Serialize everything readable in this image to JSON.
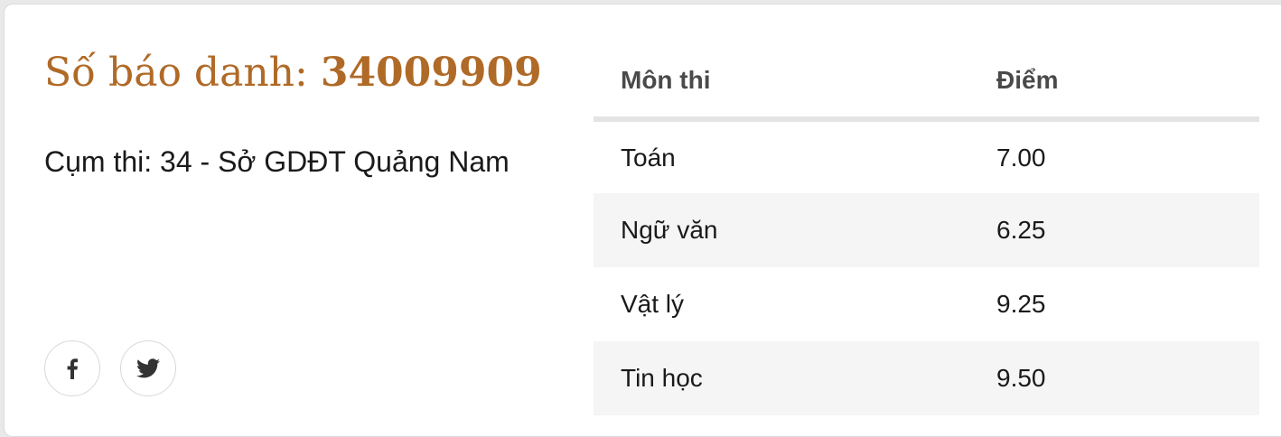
{
  "header": {
    "label": "Số báo danh:",
    "number": "34009909"
  },
  "cluster": "Cụm thi: 34 - Sở GDĐT Quảng Nam",
  "share": {
    "items": [
      {
        "icon": "facebook-icon"
      },
      {
        "icon": "twitter-icon"
      }
    ]
  },
  "table": {
    "columns": [
      "Môn thi",
      "Điểm"
    ],
    "rows": [
      {
        "subject": "Toán",
        "score": "7.00"
      },
      {
        "subject": "Ngữ văn",
        "score": "6.25"
      },
      {
        "subject": "Vật lý",
        "score": "9.25"
      },
      {
        "subject": "Tin học",
        "score": "9.50"
      }
    ]
  },
  "colors": {
    "accent": "#b06a27",
    "row_alt": "#f5f5f5",
    "header_rule": "#e4e4e4"
  }
}
